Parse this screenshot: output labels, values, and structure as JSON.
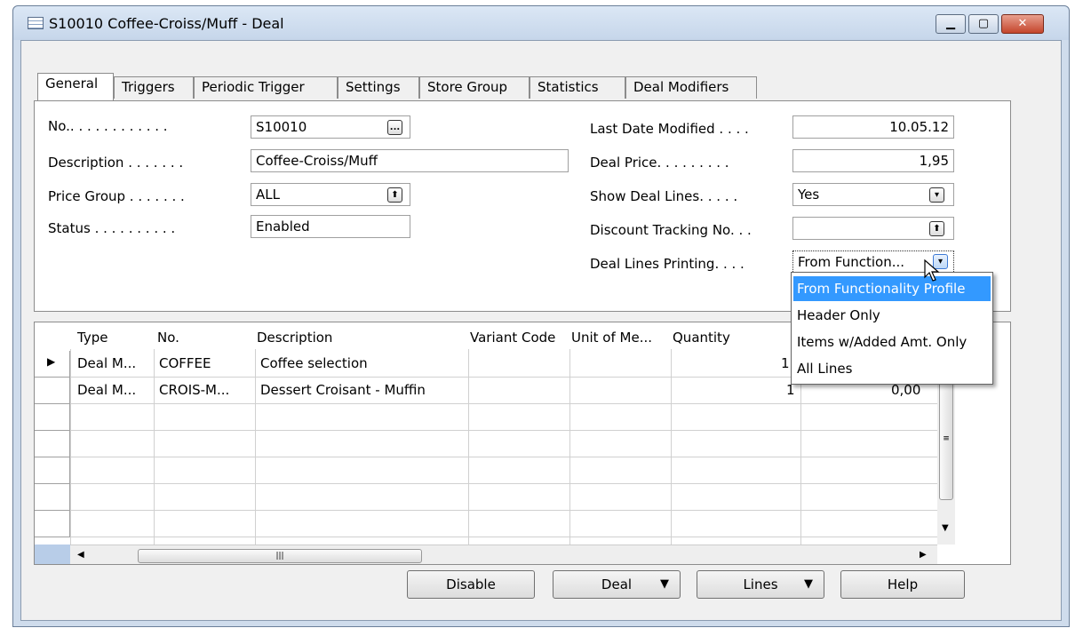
{
  "window": {
    "title": "S10010 Coffee-Croiss/Muff - Deal"
  },
  "tabs": [
    "General",
    "Triggers",
    "Periodic Trigger",
    "Settings",
    "Store Group",
    "Statistics",
    "Deal Modifiers"
  ],
  "left_fields": {
    "no_label": "No.. . . . . . . . . . . .",
    "no_value": "S10010",
    "description_label": "Description . . . . . . .",
    "description_value": "Coffee-Croiss/Muff",
    "price_group_label": "Price Group . . . . . . .",
    "price_group_value": "ALL",
    "status_label": "Status . . . . . . . . . .",
    "status_value": "Enabled"
  },
  "right_fields": {
    "last_date_label": "Last Date Modified . . . .",
    "last_date_value": "10.05.12",
    "deal_price_label": "Deal Price. . . . . . . . .",
    "deal_price_value": "1,95",
    "show_lines_label": "Show Deal Lines. . . . .",
    "show_lines_value": "Yes",
    "discount_label": "Discount Tracking No. . .",
    "discount_value": "",
    "printing_label": "Deal Lines Printing. . . .",
    "printing_value": "From Function..."
  },
  "grid": {
    "headers": [
      "Type",
      "No.",
      "Description",
      "Variant Code",
      "Unit of Me...",
      "Quantity"
    ],
    "rows": [
      {
        "type": "Deal M...",
        "no": "COFFEE",
        "description": "Coffee selection",
        "variant": "",
        "unit": "",
        "quantity": "1",
        "price": ""
      },
      {
        "type": "Deal M...",
        "no": "CROIS-M...",
        "description": "Dessert Croisant - Muffin",
        "variant": "",
        "unit": "",
        "quantity": "1",
        "price": "0,00"
      }
    ]
  },
  "dropdown": {
    "options": [
      "From Functionality Profile",
      "Header Only",
      "Items w/Added Amt. Only",
      "All Lines"
    ]
  },
  "buttons": {
    "disable": "Disable",
    "deal": "Deal",
    "lines": "Lines",
    "help": "Help"
  }
}
